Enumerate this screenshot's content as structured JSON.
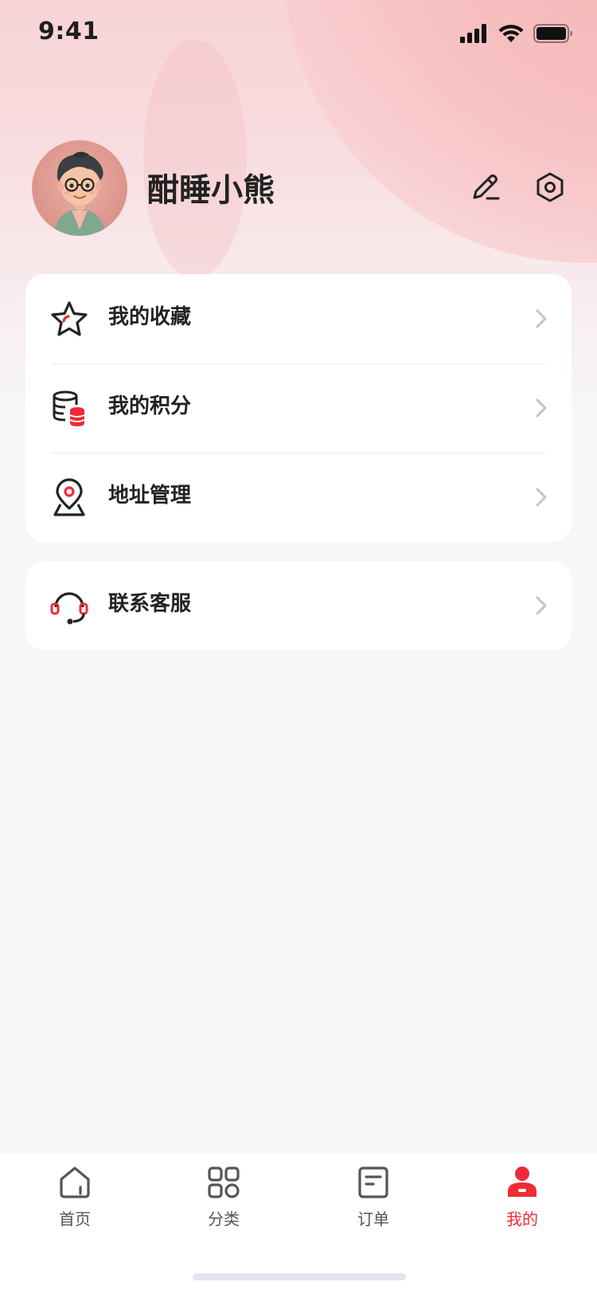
{
  "status_bar": {
    "time": "9:41",
    "icons": [
      "signal-icon",
      "wifi-icon",
      "battery-icon"
    ]
  },
  "profile": {
    "username": "酣睡小熊",
    "avatar": "avatar-image",
    "edit_icon": "edit-icon",
    "settings_icon": "settings-icon"
  },
  "menu_group1": [
    {
      "label": "我的收藏",
      "icon": "star-icon"
    },
    {
      "label": "我的积分",
      "icon": "coins-icon"
    },
    {
      "label": "地址管理",
      "icon": "location-icon"
    }
  ],
  "menu_group2": [
    {
      "label": "联系客服",
      "icon": "headset-icon"
    }
  ],
  "tabbar": [
    {
      "label": "首页",
      "icon": "home-icon",
      "active": false
    },
    {
      "label": "分类",
      "icon": "category-icon",
      "active": false
    },
    {
      "label": "订单",
      "icon": "order-icon",
      "active": false
    },
    {
      "label": "我的",
      "icon": "profile-icon",
      "active": true
    }
  ],
  "colors": {
    "accent": "#ef2b36",
    "background": "#f7f7f8",
    "card": "#ffffff"
  }
}
